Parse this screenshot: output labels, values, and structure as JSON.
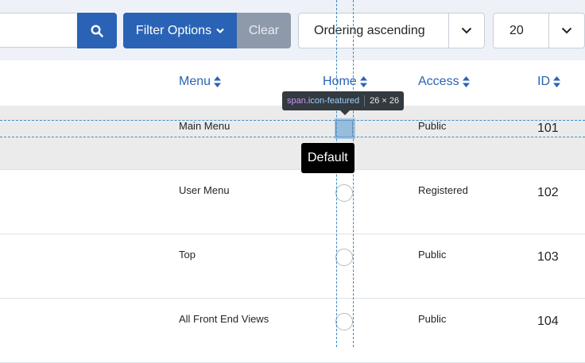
{
  "toolbar": {
    "search": {
      "placeholder": ""
    },
    "filter_label": "Filter Options",
    "clear_label": "Clear",
    "ordering": "Ordering ascending",
    "limit": "20"
  },
  "table": {
    "headers": {
      "menu": "Menu",
      "home": "Home",
      "access": "Access",
      "id": "ID"
    },
    "rows": [
      {
        "menu": "Main Menu",
        "home": "featured",
        "access": "Public",
        "id": "101"
      },
      {
        "menu": "User Menu",
        "home": "unfeatured",
        "access": "Registered",
        "id": "102"
      },
      {
        "menu": "Top",
        "home": "unfeatured",
        "access": "Public",
        "id": "103"
      },
      {
        "menu": "All Front End Views",
        "home": "unfeatured",
        "access": "Public",
        "id": "104"
      }
    ]
  },
  "inspector": {
    "tag": "span",
    "class": ".icon-featured",
    "size": "26 × 26"
  },
  "tooltip": "Default",
  "colors": {
    "primary": "#2a63b5",
    "clear": "#8e9aab",
    "toolbar_bg": "#eef2f8"
  }
}
